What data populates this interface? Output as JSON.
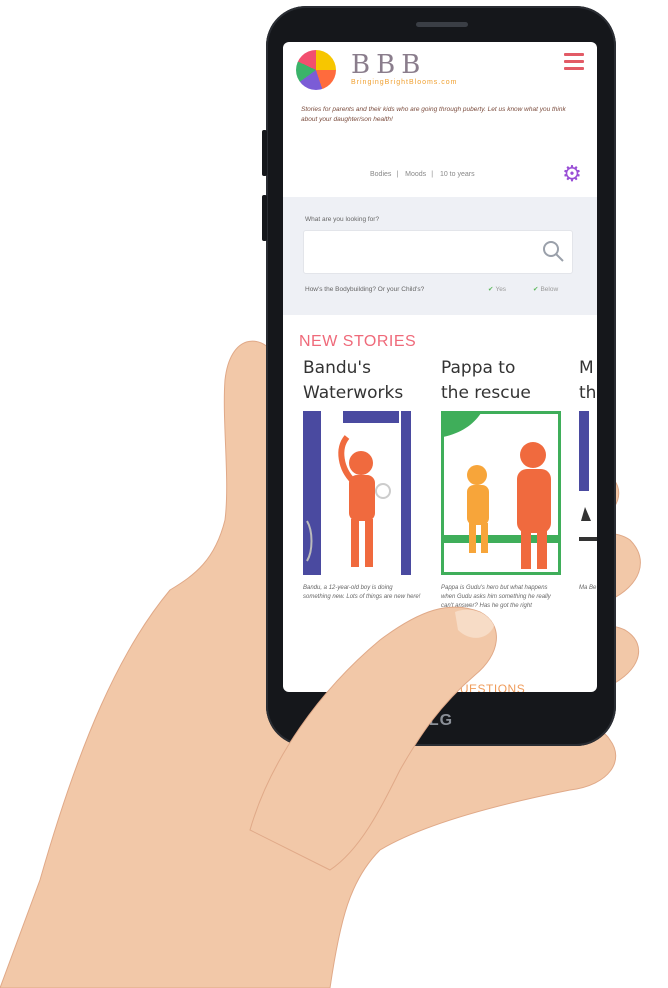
{
  "header": {
    "brand": "BBB",
    "brand_sub": "BringingBrightBlooms.com",
    "tagline": "Stories for parents and their kids who are going through puberty. Let us know what you think about your daughter/son health!"
  },
  "filters": [
    "Bodies",
    "Moods",
    "10 to years"
  ],
  "search": {
    "label": "What are you looking for?",
    "placeholder": "",
    "help": "How's the Bodybuilding? Or your Child's?",
    "check1": "Yes",
    "check2": "Below"
  },
  "sections": {
    "new_stories": "NEW STORIES",
    "faq": "ASKED QUESTIONS"
  },
  "stories": [
    {
      "title_line1": "Bandu's",
      "title_line2": "Waterworks",
      "desc": "Bandu, a 12-year-old boy is doing something new. Lots of things are new here!"
    },
    {
      "title_line1": "Pappa to",
      "title_line2": "the rescue",
      "desc": "Pappa is Gudu's hero but what happens when Gudu asks him something he really can't answer? Has he got the right gateway?"
    },
    {
      "title_line1": "M",
      "title_line2": "th",
      "desc": "Ma Be Wh Un"
    }
  ],
  "device": {
    "brand": "LG"
  },
  "colors": {
    "accent": "#ef6a7a",
    "menu": "#e25b66",
    "gear": "#9a4fd6"
  }
}
